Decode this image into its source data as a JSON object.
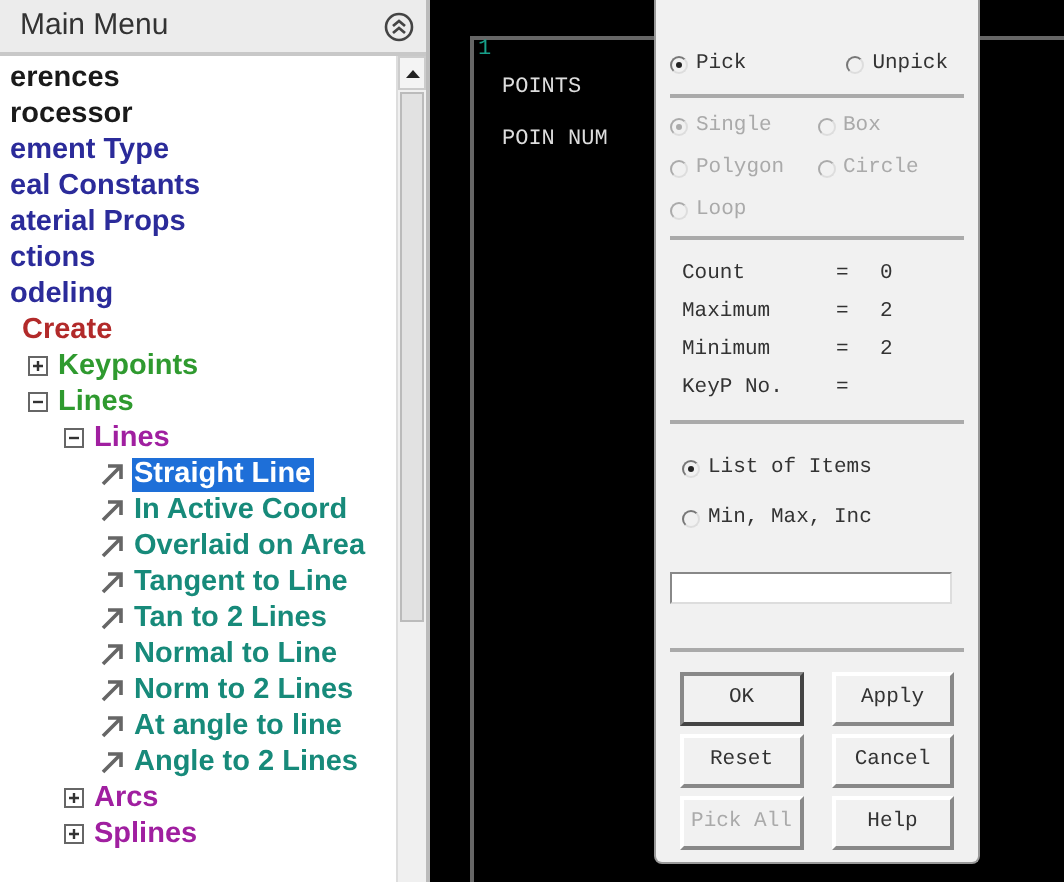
{
  "main_menu": {
    "title": "Main Menu",
    "tree": [
      {
        "label": "erences",
        "color": "#1a1a1a",
        "kind": "plain"
      },
      {
        "label": "rocessor",
        "color": "#1a1a1a",
        "kind": "plain"
      },
      {
        "label": "ement Type",
        "color": "#2b2b9a",
        "kind": "plain"
      },
      {
        "label": "eal Constants",
        "color": "#2b2b9a",
        "kind": "plain"
      },
      {
        "label": "aterial Props",
        "color": "#2b2b9a",
        "kind": "plain"
      },
      {
        "label": "ctions",
        "color": "#2b2b9a",
        "kind": "plain"
      },
      {
        "label": "odeling",
        "color": "#2b2b9a",
        "kind": "plain",
        "children": [
          {
            "label": "Create",
            "color": "#b22a2a",
            "kind": "plain",
            "children": [
              {
                "label": "Keypoints",
                "color": "#2f9a2f",
                "kind": "folder",
                "expanded": false
              },
              {
                "label": "Lines",
                "color": "#2f9a2f",
                "kind": "folder",
                "expanded": true,
                "children": [
                  {
                    "label": "Lines",
                    "color": "#a01fa0",
                    "kind": "folder",
                    "expanded": true,
                    "children": [
                      {
                        "label": "Straight Line",
                        "kind": "action",
                        "selected": true
                      },
                      {
                        "label": "In Active Coord",
                        "color": "#178a7a",
                        "kind": "action",
                        "selected": false
                      },
                      {
                        "label": "Overlaid on Area",
                        "color": "#178a7a",
                        "kind": "action",
                        "selected": false
                      },
                      {
                        "label": "Tangent to Line",
                        "color": "#178a7a",
                        "kind": "action",
                        "selected": false
                      },
                      {
                        "label": "Tan to 2 Lines",
                        "color": "#178a7a",
                        "kind": "action",
                        "selected": false
                      },
                      {
                        "label": "Normal to Line",
                        "color": "#178a7a",
                        "kind": "action",
                        "selected": false
                      },
                      {
                        "label": "Norm to 2 Lines",
                        "color": "#178a7a",
                        "kind": "action",
                        "selected": false
                      },
                      {
                        "label": "At angle to line",
                        "color": "#178a7a",
                        "kind": "action",
                        "selected": false
                      },
                      {
                        "label": "Angle to 2 Lines",
                        "color": "#178a7a",
                        "kind": "action",
                        "selected": false
                      }
                    ]
                  },
                  {
                    "label": "Arcs",
                    "color": "#a01fa0",
                    "kind": "folder",
                    "expanded": false
                  },
                  {
                    "label": "Splines",
                    "color": "#a01fa0",
                    "kind": "folder",
                    "expanded": false
                  }
                ]
              }
            ]
          }
        ]
      }
    ]
  },
  "graphics": {
    "window_number": "1",
    "lines": [
      "POINTS",
      "POIN NUM"
    ]
  },
  "picker": {
    "mode": [
      {
        "label": "Pick",
        "selected": true
      },
      {
        "label": "Unpick",
        "selected": false
      }
    ],
    "shape": [
      {
        "label": "Single",
        "selected": true
      },
      {
        "label": "Box",
        "selected": false
      },
      {
        "label": "Polygon",
        "selected": false
      },
      {
        "label": "Circle",
        "selected": false
      },
      {
        "label": "Loop",
        "selected": false
      }
    ],
    "shape_disabled": true,
    "stats": [
      {
        "label": "Count",
        "sign": "=",
        "value": "0"
      },
      {
        "label": "Maximum",
        "sign": "=",
        "value": "2"
      },
      {
        "label": "Minimum",
        "sign": "=",
        "value": "2"
      },
      {
        "label": "KeyP No.",
        "sign": "="
      }
    ],
    "entry": [
      {
        "label": "List of Items",
        "selected": true
      },
      {
        "label": "Min, Max, Inc",
        "selected": false
      }
    ],
    "buttons": [
      {
        "label": "OK",
        "disabled": false,
        "default": true
      },
      {
        "label": "Apply",
        "disabled": false,
        "default": false
      },
      {
        "label": "Reset",
        "disabled": false,
        "default": false
      },
      {
        "label": "Cancel",
        "disabled": false,
        "default": false
      },
      {
        "label": "Pick All",
        "disabled": true,
        "default": false
      },
      {
        "label": "Help",
        "disabled": false,
        "default": false
      }
    ]
  }
}
